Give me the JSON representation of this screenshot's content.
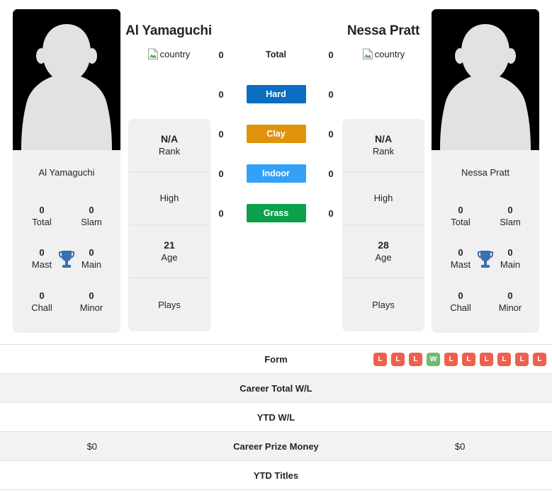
{
  "players": {
    "left": {
      "name": "Al Yamaguchi",
      "card_name": "Al Yamaguchi",
      "country_alt": "country",
      "rank": "N/A",
      "rank_label": "Rank",
      "high_label": "High",
      "high_value": "",
      "age": "21",
      "age_label": "Age",
      "plays_label": "Plays",
      "plays_value": "",
      "titles": {
        "total": "0",
        "total_label": "Total",
        "slam": "0",
        "slam_label": "Slam",
        "mast": "0",
        "mast_label": "Mast",
        "main": "0",
        "main_label": "Main",
        "chall": "0",
        "chall_label": "Chall",
        "minor": "0",
        "minor_label": "Minor"
      },
      "surface_wins": {
        "total": "0",
        "hard": "0",
        "clay": "0",
        "indoor": "0",
        "grass": "0"
      },
      "career_total_wl": "",
      "ytd_wl": "",
      "career_prize_money": "$0",
      "ytd_titles": ""
    },
    "right": {
      "name": "Nessa Pratt",
      "card_name": "Nessa Pratt",
      "country_alt": "country",
      "rank": "N/A",
      "rank_label": "Rank",
      "high_label": "High",
      "high_value": "",
      "age": "28",
      "age_label": "Age",
      "plays_label": "Plays",
      "plays_value": "",
      "titles": {
        "total": "0",
        "total_label": "Total",
        "slam": "0",
        "slam_label": "Slam",
        "mast": "0",
        "mast_label": "Mast",
        "main": "0",
        "main_label": "Main",
        "chall": "0",
        "chall_label": "Chall",
        "minor": "0",
        "minor_label": "Minor"
      },
      "surface_wins": {
        "total": "0",
        "hard": "0",
        "clay": "0",
        "indoor": "0",
        "grass": "0"
      },
      "career_total_wl": "",
      "ytd_wl": "",
      "career_prize_money": "$0",
      "ytd_titles": ""
    }
  },
  "surfaces": [
    {
      "label": "Total",
      "color": "transparent",
      "plain": true
    },
    {
      "label": "Hard",
      "color": "#0b6ec1"
    },
    {
      "label": "Clay",
      "color": "#df930b"
    },
    {
      "label": "Grass",
      "color": "#0ca04a"
    },
    {
      "label": "Indoor",
      "color": "#33a1f7"
    }
  ],
  "surface_rows": [
    {
      "label": "Total",
      "left": "0",
      "right": "0"
    },
    {
      "label": "Hard",
      "left": "0",
      "right": "0"
    },
    {
      "label": "Clay",
      "left": "0",
      "right": "0"
    },
    {
      "label": "Indoor",
      "left": "0",
      "right": "0"
    },
    {
      "label": "Grass",
      "left": "0",
      "right": "0"
    }
  ],
  "table": {
    "rows": [
      {
        "label": "Form",
        "left": "",
        "right": ""
      },
      {
        "label": "Career Total W/L",
        "left": "",
        "right": ""
      },
      {
        "label": "YTD W/L",
        "left": "",
        "right": ""
      },
      {
        "label": "Career Prize Money",
        "left": "$0",
        "right": "$0"
      },
      {
        "label": "YTD Titles",
        "left": "",
        "right": ""
      }
    ]
  },
  "form": {
    "right_results": [
      "L",
      "L",
      "L",
      "W",
      "L",
      "L",
      "L",
      "L",
      "L",
      "L"
    ],
    "left_results": [],
    "win_color": "#6cbb72",
    "loss_color": "#ef5f4c"
  },
  "colors": {
    "hard": "#0b6ec1",
    "clay": "#df930b",
    "indoor": "#33a1f7",
    "grass": "#0ca04a",
    "trophy": "#3a6fb0",
    "card_bg": "#f0f0f0",
    "row_alt_bg": "#f2f2f2",
    "border": "#dee2e6"
  }
}
